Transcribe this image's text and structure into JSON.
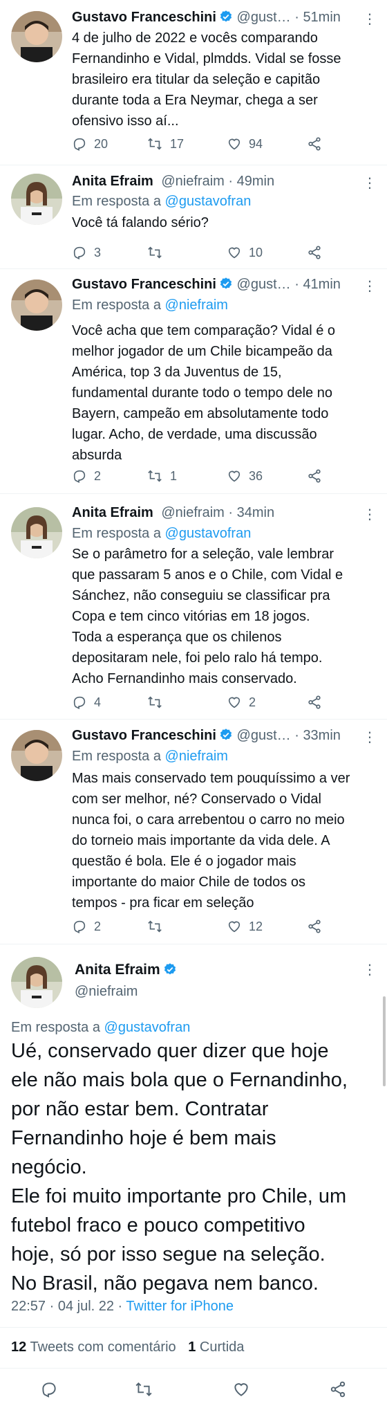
{
  "tweets": [
    {
      "name": "Gustavo Franceschini",
      "handle": "@gust…",
      "separator": "·",
      "time": "51min",
      "reply_prefix": "",
      "reply_to": "",
      "text": "4 de julho de 2022 e vocês comparando\nFernandinho e Vidal, plmdds. Vidal se fosse\nbrasileiro era titular da seleção e capitão\ndurante toda a Era Neymar, chega a ser\nofensivo isso aí...",
      "replies": "20",
      "retweets": "17",
      "likes": "94"
    },
    {
      "name": "Anita Efraim",
      "handle": "@niefraim",
      "separator": "·",
      "time": "49min",
      "reply_prefix": "Em resposta a ",
      "reply_to": "@gustavofran",
      "text": "Você tá falando sério?",
      "replies": "3",
      "retweets": "",
      "likes": "10"
    },
    {
      "name": "Gustavo Franceschini",
      "handle": "@gust…",
      "separator": "·",
      "time": "41min",
      "reply_prefix": "Em resposta a ",
      "reply_to": "@niefraim",
      "text": "Você acha que tem comparação? Vidal é o\nmelhor jogador de um Chile bicampeão da\nAmérica, top 3 da Juventus de 15,\nfundamental durante todo o tempo dele no\nBayern, campeão em absolutamente todo\nlugar. Acho, de verdade, uma discussão\nabsurda",
      "replies": "2",
      "retweets": "1",
      "likes": "36"
    },
    {
      "name": "Anita Efraim",
      "handle": "@niefraim",
      "separator": "·",
      "time": "34min",
      "reply_prefix": "Em resposta a ",
      "reply_to": "@gustavofran",
      "text": "Se o parâmetro for a seleção, vale lembrar\nque passaram 5 anos e o Chile, com Vidal e\nSánchez, não conseguiu se classificar pra\nCopa e tem cinco vitórias em 18 jogos.\nToda a esperança que os chilenos\ndepositaram nele, foi pelo ralo há tempo.\nAcho Fernandinho mais conservado.",
      "replies": "4",
      "retweets": "",
      "likes": "2"
    },
    {
      "name": "Gustavo Franceschini",
      "handle": "@gust…",
      "separator": "·",
      "time": "33min",
      "reply_prefix": "Em resposta a ",
      "reply_to": "@niefraim",
      "text": "Mas mais conservado tem pouquíssimo a ver\ncom ser melhor, né? Conservado o Vidal\nnunca foi, o cara arrebentou o carro no meio\ndo torneio mais importante da vida dele. A\nquestão é bola. Ele é o jogador mais\nimportante do maior Chile de todos os\ntempos - pra ficar em seleção",
      "replies": "2",
      "retweets": "",
      "likes": "12"
    }
  ],
  "main_tweet": {
    "name": "Anita Efraim",
    "handle": "@niefraim",
    "reply_prefix": "Em resposta a ",
    "reply_to": "@gustavofran",
    "text": "Ué, conservado quer dizer que hoje\nele não mais bola que o Fernandinho,\npor não estar bem. Contratar\nFernandinho hoje é bem mais\nnegócio.\nEle foi muito importante pro Chile, um\nfutebol fraco e pouco competitivo\nhoje, só por isso segue na seleção.\nNo Brasil, não pegava nem banco.",
    "time": "22:57 · 04 jul. 22 · ",
    "source": "Twitter for iPhone",
    "quote_count": "12",
    "quote_label": "Tweets com comentário",
    "like_count": "1",
    "like_label": "Curtida"
  },
  "colors": {
    "link": "#1d9bf0",
    "secondary": "#536471",
    "verified": "#1d9bf0"
  },
  "icons": [
    "reply-icon",
    "retweet-icon",
    "like-icon",
    "share-icon",
    "verified-badge-icon",
    "more-icon"
  ]
}
